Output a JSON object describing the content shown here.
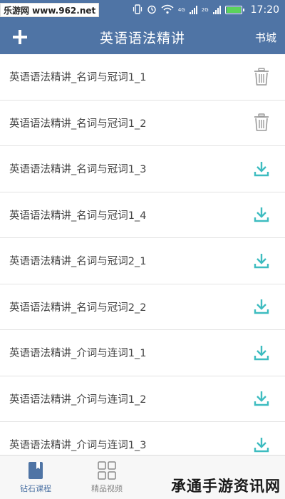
{
  "status_bar": {
    "watermark": "乐游网 www.962.net",
    "network_1": "4G",
    "network_2": "2G",
    "time": "17:20"
  },
  "header": {
    "add_icon": "plus-icon",
    "title": "英语语法精讲",
    "store_label": "书城"
  },
  "lessons": [
    {
      "title": "英语语法精讲_名词与冠词1_1",
      "action": "delete"
    },
    {
      "title": "英语语法精讲_名词与冠词1_2",
      "action": "delete"
    },
    {
      "title": "英语语法精讲_名词与冠词1_3",
      "action": "download"
    },
    {
      "title": "英语语法精讲_名词与冠词1_4",
      "action": "download"
    },
    {
      "title": "英语语法精讲_名词与冠词2_1",
      "action": "download"
    },
    {
      "title": "英语语法精讲_名词与冠词2_2",
      "action": "download"
    },
    {
      "title": "英语语法精讲_介词与连词1_1",
      "action": "download"
    },
    {
      "title": "英语语法精讲_介词与连词1_2",
      "action": "download"
    },
    {
      "title": "英语语法精讲_介词与连词1_3",
      "action": "download"
    }
  ],
  "tabs": [
    {
      "label": "钻石课程",
      "icon": "bookmark-book-icon",
      "active": true
    },
    {
      "label": "精品视频",
      "icon": "grid-icon",
      "active": false
    }
  ],
  "watermark_bottom": "承通手游资讯网",
  "colors": {
    "header_bg": "#4f74a5",
    "download_icon": "#3dbcc0",
    "delete_icon": "#9a9a9a",
    "active_tab": "#4f74a5"
  }
}
